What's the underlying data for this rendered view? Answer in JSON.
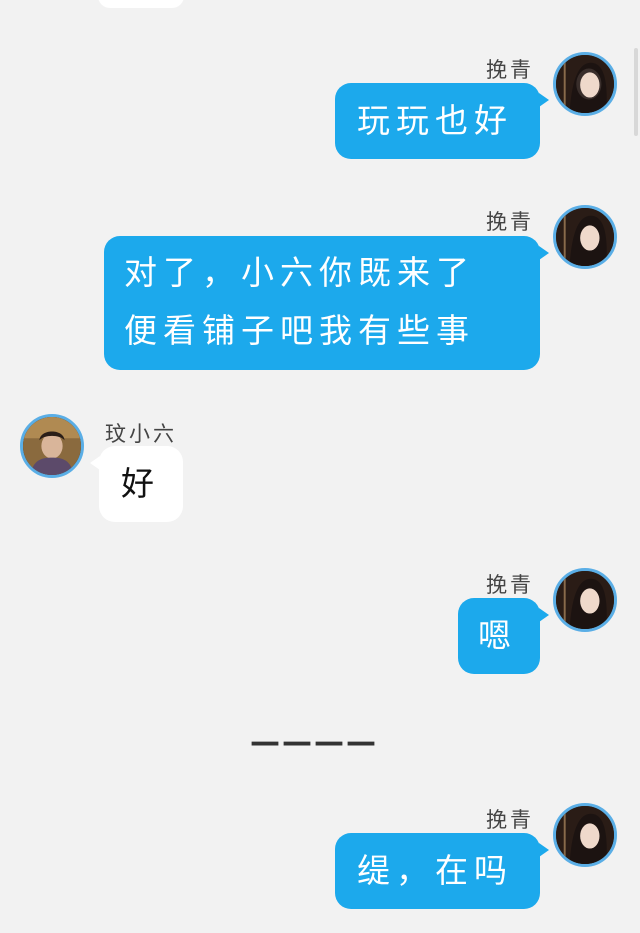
{
  "chat": {
    "messages": [
      {
        "sender": "挽青",
        "text": "玩玩也好",
        "side": "right"
      },
      {
        "sender": "挽青",
        "text": "对了，小六你既来了\n便看铺子吧我有些事",
        "side": "right"
      },
      {
        "sender": "玟小六",
        "text": "好",
        "side": "left"
      },
      {
        "sender": "挽青",
        "text": "嗯",
        "side": "right"
      },
      {
        "sender": "挽青",
        "text": "缇，在吗",
        "side": "right"
      }
    ],
    "divider": "————"
  },
  "icons": {
    "self_avatar": "woman-portrait-avatar",
    "other_avatar": "man-portrait-avatar"
  },
  "colors": {
    "background": "#f2f2f2",
    "self_bubble": "#1ca9ec",
    "other_bubble": "#ffffff",
    "avatar_ring": "#5aaee6"
  }
}
